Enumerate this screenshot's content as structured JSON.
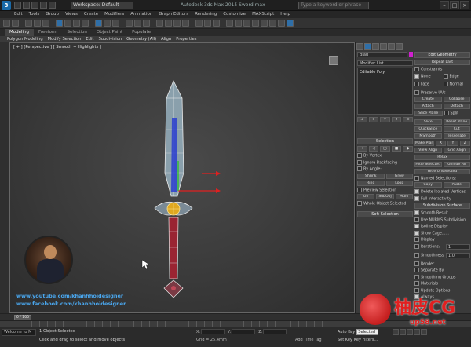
{
  "titlebar": {
    "logo": "3",
    "workspace": "Workspace: Default",
    "title": "Autodesk 3ds Max 2015   Sword.max",
    "search_placeholder": "Type a keyword or phrase"
  },
  "menus": [
    "Edit",
    "Tools",
    "Group",
    "Views",
    "Create",
    "Modifiers",
    "Animation",
    "Graph Editors",
    "Rendering",
    "Customize",
    "MAXScript",
    "Help"
  ],
  "ribbon": {
    "tabs": [
      "Modeling",
      "Freeform",
      "Selection",
      "Object Paint",
      "Populate"
    ],
    "active_tab": "Modeling",
    "sub": [
      "Polygon Modeling",
      "Modify Selection",
      "Edit",
      "Subdivision",
      "Geometry (All)",
      "Align",
      "Properties"
    ]
  },
  "viewport": {
    "label": "[ + ] [Perspective ] [ Smooth + Highlights ]"
  },
  "social": {
    "youtube": "www.youtube.com/khanhhoidesigner",
    "facebook": "www.facebook.com/khanhhoidesigner"
  },
  "command_panel": {
    "object_name": "Blad",
    "modifier_list": "Modifier List",
    "stack_item": "Editable Poly",
    "selection_title": "Selection",
    "by_vertex": "By Vertex",
    "ignore_backfacing": "Ignore Backfacing",
    "by_angle": "By Angle:",
    "shrink": "Shrink",
    "grow": "Grow",
    "ring": "Ring",
    "loop": "Loop",
    "preview_selection": "Preview Selection",
    "off": "Off",
    "subobj": "SubObj",
    "multi": "Multi",
    "whole_object": "Whole Object Selected",
    "soft_selection": "Soft Selection",
    "edit_geometry": "Edit Geometry",
    "repeat_last": "Repeat Last",
    "constraints": "Constraints",
    "none": "None",
    "edge": "Edge",
    "face": "Face",
    "normal": "Normal",
    "preserve_uvs": "Preserve UVs",
    "create": "Create",
    "collapse": "Collapse",
    "attach": "Attach",
    "detach": "Detach",
    "slice_plane": "Slice Plane",
    "split": "Split",
    "slice": "Slice",
    "reset_plane": "Reset Plane",
    "quickslice": "QuickSlice",
    "cut": "Cut",
    "msmooth": "MSmooth",
    "tessellate": "Tessellate",
    "make_planar": "Make Planar",
    "x": "X",
    "y": "Y",
    "z": "Z",
    "view_align": "View Align",
    "grid_align": "Grid Align",
    "relax": "Relax",
    "hide_selected": "Hide Selected",
    "unhide_all": "Unhide All",
    "hide_unselected": "Hide Unselected",
    "named_selections": "Named Selections:",
    "copy": "Copy",
    "paste": "Paste",
    "delete_isolated": "Delete Isolated Vertices",
    "full_interactivity": "Full Interactivity",
    "subdivision_surface": "Subdivision Surface",
    "smooth_result": "Smooth Result",
    "use_nurms": "Use NURMS Subdivision",
    "isoline_display": "Isoline Display",
    "show_cage": "Show Cage......",
    "display": "Display",
    "iterations_label": "Iterations:",
    "iterations_value": "1",
    "smoothness_label": "Smoothness:",
    "smoothness_value": "1.0",
    "render": "Render",
    "separate_by": "Separate By",
    "smoothing_groups": "Smoothing Groups",
    "materials": "Materials",
    "update_options": "Update Options",
    "always": "Always"
  },
  "timeline": {
    "slider": "0 / 100"
  },
  "status": {
    "maxscript": "Welcome to M",
    "line1": "1 Object Selected",
    "line2": "Click and drag to select and move objects",
    "x": "X:",
    "y": "Y:",
    "z": "Z:",
    "grid": "Grid = 25.4mm",
    "add_time_tag": "Add Time Tag",
    "auto_key": "Auto Key",
    "selected": "Selected",
    "set_key": "Set Key",
    "key_filters": "Key Filters..."
  },
  "watermark": {
    "brand": "柚皮CG",
    "url": "up58.net"
  },
  "colors": {
    "accent": "#2f6fa8",
    "social_text": "#4aa8f0",
    "watermark": "#e02020",
    "object_color": "#d020d0"
  }
}
